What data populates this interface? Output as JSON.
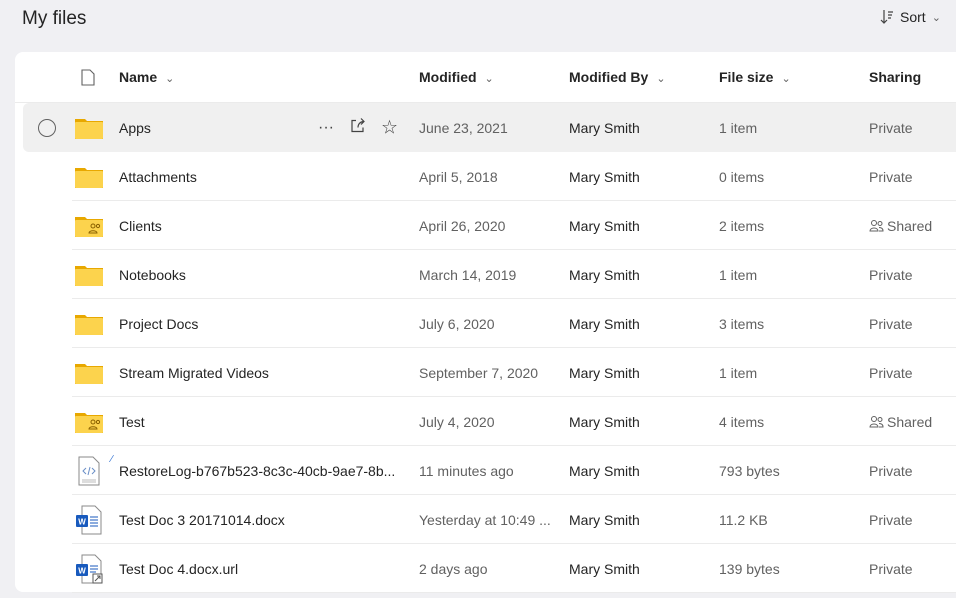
{
  "page": {
    "title": "My files",
    "sort_label": "Sort"
  },
  "columns": {
    "name": "Name",
    "modified": "Modified",
    "modified_by": "Modified By",
    "file_size": "File size",
    "sharing": "Sharing"
  },
  "files": [
    {
      "name": "Apps",
      "type": "folder",
      "modified": "June 23, 2021",
      "modified_by": "Mary Smith",
      "size": "1 item",
      "sharing": "Private",
      "hover": true
    },
    {
      "name": "Attachments",
      "type": "folder",
      "modified": "April 5, 2018",
      "modified_by": "Mary Smith",
      "size": "0 items",
      "sharing": "Private"
    },
    {
      "name": "Clients",
      "type": "shared-folder",
      "modified": "April 26, 2020",
      "modified_by": "Mary Smith",
      "size": "2 items",
      "sharing": "Shared"
    },
    {
      "name": "Notebooks",
      "type": "folder",
      "modified": "March 14, 2019",
      "modified_by": "Mary Smith",
      "size": "1 item",
      "sharing": "Private"
    },
    {
      "name": "Project Docs",
      "type": "folder",
      "modified": "July 6, 2020",
      "modified_by": "Mary Smith",
      "size": "3 items",
      "sharing": "Private"
    },
    {
      "name": "Stream Migrated Videos",
      "type": "folder",
      "modified": "September 7, 2020",
      "modified_by": "Mary Smith",
      "size": "1 item",
      "sharing": "Private"
    },
    {
      "name": "Test",
      "type": "shared-folder",
      "modified": "July 4, 2020",
      "modified_by": "Mary Smith",
      "size": "4 items",
      "sharing": "Shared"
    },
    {
      "name": "RestoreLog-b767b523-8c3c-40cb-9ae7-8b...",
      "type": "code",
      "modified": "11 minutes ago",
      "modified_by": "Mary Smith",
      "size": "793 bytes",
      "sharing": "Private",
      "new": true
    },
    {
      "name": "Test Doc 3 20171014.docx",
      "type": "word",
      "modified": "Yesterday at 10:49 ...",
      "modified_by": "Mary Smith",
      "size": "11.2 KB",
      "sharing": "Private"
    },
    {
      "name": "Test Doc 4.docx.url",
      "type": "word-link",
      "modified": "2 days ago",
      "modified_by": "Mary Smith",
      "size": "139 bytes",
      "sharing": "Private"
    }
  ],
  "colors": {
    "folder": "#f7c42f",
    "word": "#185abd",
    "background": "#f0f0f3",
    "hover": "#f0f0f0"
  }
}
